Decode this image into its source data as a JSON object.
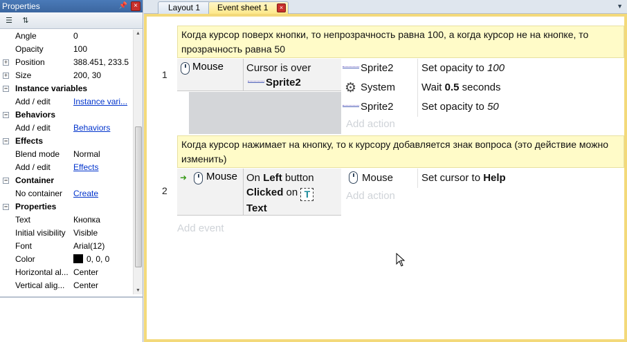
{
  "properties": {
    "title": "Properties",
    "rows": [
      {
        "kind": "prop",
        "key": "Angle",
        "value": "0"
      },
      {
        "kind": "prop",
        "key": "Opacity",
        "value": "100"
      },
      {
        "kind": "prop",
        "key": "Position",
        "value": "388.451, 233.5",
        "expand": "+"
      },
      {
        "kind": "prop",
        "key": "Size",
        "value": "200, 30",
        "expand": "+"
      },
      {
        "kind": "cat",
        "key": "Instance variables"
      },
      {
        "kind": "prop",
        "key": "Add / edit",
        "value": "Instance vari...",
        "link": true
      },
      {
        "kind": "cat",
        "key": "Behaviors"
      },
      {
        "kind": "prop",
        "key": "Add / edit",
        "value": "Behaviors",
        "link": true
      },
      {
        "kind": "cat",
        "key": "Effects"
      },
      {
        "kind": "prop",
        "key": "Blend mode",
        "value": "Normal"
      },
      {
        "kind": "prop",
        "key": "Add / edit",
        "value": "Effects",
        "link": true
      },
      {
        "kind": "cat",
        "key": "Container"
      },
      {
        "kind": "prop",
        "key": "No container",
        "value": "Create",
        "link": true
      },
      {
        "kind": "cat",
        "key": "Properties"
      },
      {
        "kind": "prop",
        "key": "Text",
        "value": "Кнопка"
      },
      {
        "kind": "prop",
        "key": "Initial visibility",
        "value": "Visible"
      },
      {
        "kind": "prop",
        "key": "Font",
        "value": "Arial(12)"
      },
      {
        "kind": "prop",
        "key": "Color",
        "value": "0, 0, 0",
        "swatch": "#000000"
      },
      {
        "kind": "prop",
        "key": "Horizontal al...",
        "value": "Center"
      },
      {
        "kind": "prop",
        "key": "Vertical alig...",
        "value": "Center"
      }
    ]
  },
  "tabs": {
    "layout": "Layout 1",
    "events": "Event sheet 1"
  },
  "events": [
    {
      "number": "1",
      "comment": "Когда курсор поверх кнопки, то непрозрачность равна 100, а когда курсор не на кнопке, то прозрачность равна 50",
      "condition_object": "Mouse",
      "condition_text": "Cursor is over",
      "condition_target": "Sprite2",
      "actions": [
        {
          "object": "Sprite2",
          "pre": "Set opacity to ",
          "em": "100"
        },
        {
          "object": "System",
          "pre": "Wait ",
          "bold": "0.5",
          "post": " seconds"
        },
        {
          "object": "Sprite2",
          "pre": "Set opacity to ",
          "em": "50"
        }
      ],
      "add_action": "Add action"
    },
    {
      "number": "2",
      "comment": "Когда курсор нажимает на кнопку, то к курсору добавляется знак вопроса (это действие можно изменить)",
      "condition_object": "Mouse",
      "condition_parts": {
        "on": "On ",
        "left": "Left",
        "button": " button",
        "clicked": "Clicked",
        "on2": " on ",
        "text": "Text"
      },
      "actions": [
        {
          "object": "Mouse",
          "pre": "Set cursor to ",
          "bold": "Help"
        }
      ],
      "add_action": "Add action"
    }
  ],
  "add_event": "Add event"
}
